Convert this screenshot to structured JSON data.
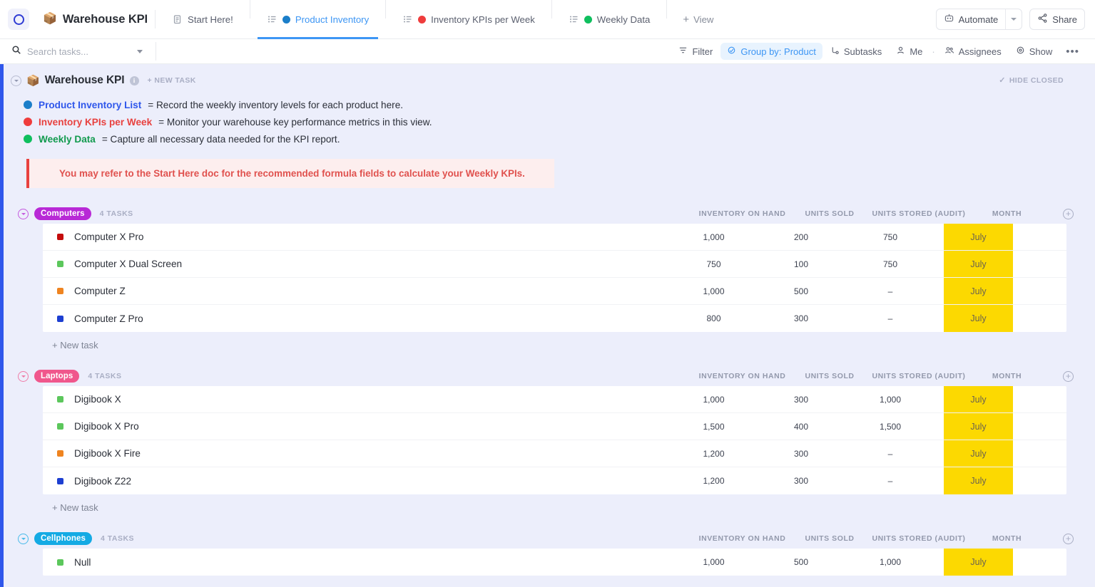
{
  "topbar": {
    "logo_icon": "clickup-ring-icon",
    "space_emoji": "📦",
    "space_title": "Warehouse KPI",
    "tabs": [
      {
        "label": "Start Here!",
        "icon": "doc-icon",
        "dot": null,
        "active": false
      },
      {
        "label": "Product Inventory",
        "icon": "list-icon",
        "dot": "#1b7ec9",
        "active": true
      },
      {
        "label": "Inventory KPIs per Week",
        "icon": "list-icon",
        "dot": "#ef3c3c",
        "active": false
      },
      {
        "label": "Weekly Data",
        "icon": "list-icon",
        "dot": "#0fbf5e",
        "active": false
      }
    ],
    "add_view_label": "View",
    "automate_label": "Automate",
    "automate_icon": "robot-icon",
    "share_label": "Share",
    "share_icon": "share-icon"
  },
  "toolbar": {
    "search_placeholder": "Search tasks...",
    "search_value": "",
    "search_icon": "search-icon",
    "items": [
      {
        "label": "Filter",
        "icon": "filter-icon",
        "highlight": false
      },
      {
        "label": "Group by: Product",
        "icon": "group-icon",
        "highlight": true
      },
      {
        "label": "Subtasks",
        "icon": "subtasks-icon",
        "highlight": false
      },
      {
        "label": "Me",
        "icon": "person-icon",
        "highlight": false
      },
      {
        "label": "Assignees",
        "icon": "people-icon",
        "highlight": false
      },
      {
        "label": "Show",
        "icon": "eye-icon",
        "highlight": false
      }
    ],
    "more_label": "•••"
  },
  "list_header": {
    "emoji": "📦",
    "title": "Warehouse KPI",
    "info_icon": "info-icon",
    "new_task_label": "+ NEW TASK",
    "hide_closed_label": "HIDE CLOSED",
    "hide_closed_icon": "check-icon"
  },
  "legend": [
    {
      "dot": "#1b7ec9",
      "name": "Product Inventory List",
      "name_color": "#2f57eb",
      "text": "= Record the weekly inventory levels for each product here."
    },
    {
      "dot": "#ef3c3c",
      "name": "Inventory KPIs per Week",
      "name_color": "#e8413f",
      "text": "= Monitor your warehouse key performance metrics in this view."
    },
    {
      "dot": "#0fbf5e",
      "name": "Weekly Data",
      "name_color": "#119a4e",
      "text": "= Capture all necessary data needed for the KPI report."
    }
  ],
  "callout": {
    "text": "You may refer to the Start Here doc for the recommended formula fields to calculate your Weekly KPIs.",
    "bar_color": "#e8413f",
    "bg_color": "#fdeeee"
  },
  "columns": [
    {
      "key": "inventory_on_hand",
      "label": "INVENTORY ON HAND",
      "width_class": "w-inv"
    },
    {
      "key": "units_sold",
      "label": "UNITS SOLD",
      "width_class": "w-sold"
    },
    {
      "key": "units_stored_audit",
      "label": "UNITS STORED (AUDIT)",
      "width_class": "w-audit"
    },
    {
      "key": "month",
      "label": "MONTH",
      "width_class": "w-month"
    }
  ],
  "month_cell_color": "#fcd901",
  "new_task_row_label": "+ New task",
  "groups": [
    {
      "name": "Computers",
      "chip_color": "#b829d6",
      "caret_color": "#b829d6",
      "count_label": "4 TASKS",
      "rows": [
        {
          "dot": "#c40c0c",
          "name": "Computer X Pro",
          "inventory_on_hand": "1,000",
          "units_sold": "200",
          "units_stored_audit": "750",
          "month": "July"
        },
        {
          "dot": "#5cc75c",
          "name": "Computer X Dual Screen",
          "inventory_on_hand": "750",
          "units_sold": "100",
          "units_stored_audit": "750",
          "month": "July"
        },
        {
          "dot": "#ef8420",
          "name": "Computer Z",
          "inventory_on_hand": "1,000",
          "units_sold": "500",
          "units_stored_audit": "–",
          "month": "July"
        },
        {
          "dot": "#1d3fd1",
          "name": "Computer Z Pro",
          "inventory_on_hand": "800",
          "units_sold": "300",
          "units_stored_audit": "–",
          "month": "July"
        }
      ]
    },
    {
      "name": "Laptops",
      "chip_color": "#f0578c",
      "caret_color": "#f0578c",
      "count_label": "4 TASKS",
      "rows": [
        {
          "dot": "#5cc75c",
          "name": "Digibook X",
          "inventory_on_hand": "1,000",
          "units_sold": "300",
          "units_stored_audit": "1,000",
          "month": "July"
        },
        {
          "dot": "#5cc75c",
          "name": "Digibook X Pro",
          "inventory_on_hand": "1,500",
          "units_sold": "400",
          "units_stored_audit": "1,500",
          "month": "July"
        },
        {
          "dot": "#ef8420",
          "name": "Digibook X Fire",
          "inventory_on_hand": "1,200",
          "units_sold": "300",
          "units_stored_audit": "–",
          "month": "July"
        },
        {
          "dot": "#1d3fd1",
          "name": "Digibook Z22",
          "inventory_on_hand": "1,200",
          "units_sold": "300",
          "units_stored_audit": "–",
          "month": "July"
        }
      ]
    },
    {
      "name": "Cellphones",
      "chip_color": "#14aae4",
      "caret_color": "#14aae4",
      "count_label": "4 TASKS",
      "rows": [
        {
          "dot": "#5cc75c",
          "name": "Null",
          "inventory_on_hand": "1,000",
          "units_sold": "500",
          "units_stored_audit": "1,000",
          "month": "July"
        }
      ]
    }
  ]
}
